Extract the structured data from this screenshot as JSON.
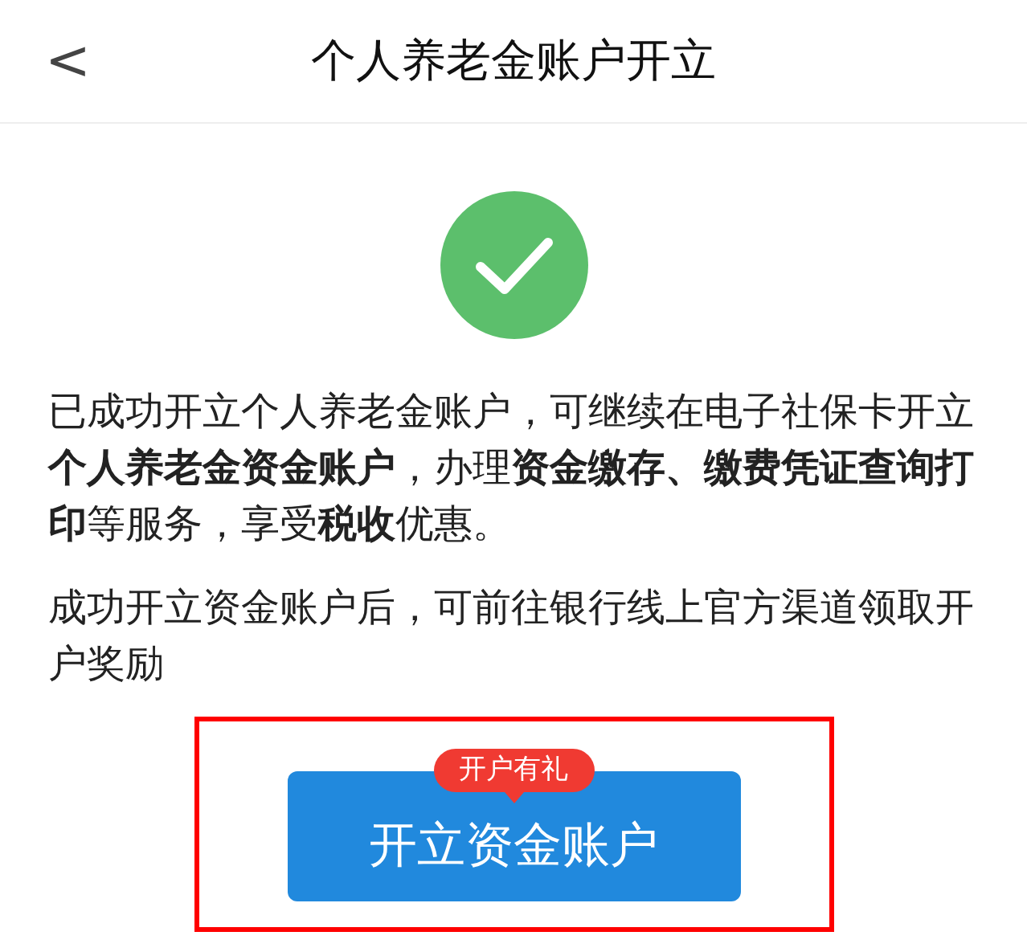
{
  "header": {
    "back": "<",
    "title": "个人养老金账户开立"
  },
  "status": {
    "kind": "success"
  },
  "paragraphs": [
    "已成功开立个人养老金账户，可继续在电子社保卡开立**个人养老金资金账户**，办理**资金缴存、缴费凭证查询打印**等服务，享受**税收**优惠。",
    "成功开立资金账户后，可前往银行线上官方渠道领取开户奖励"
  ],
  "action": {
    "label": "开立资金账户",
    "badge": "开户有礼",
    "highlighted": true
  }
}
